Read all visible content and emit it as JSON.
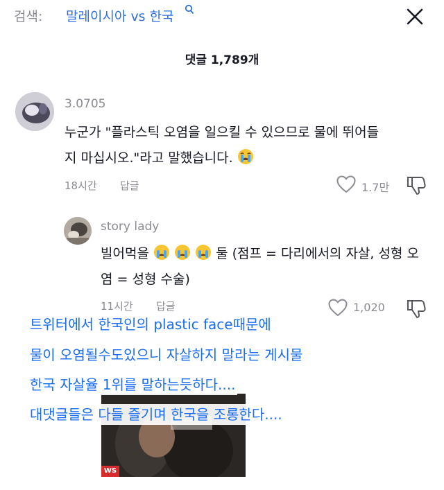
{
  "header": {
    "search_prefix": "검색:",
    "search_query": "말레이시아 vs 한국",
    "search_icon": "search-icon",
    "close_icon": "close-icon"
  },
  "comments_count": "댓글 1,789개",
  "comment": {
    "username": "3.0705",
    "text": "누군가 \"플라스틱 오염을 일으킬 수 있으므로 물에 뛰어들지 마십시오.\"라고 말했습니다.",
    "emoji": "crying-emoji",
    "time": "18시간",
    "reply_label": "답글",
    "likes": "1.7만"
  },
  "reply": {
    "username": "story lady",
    "text_before": "빌어먹을",
    "text_after": "둘 (점프 = 다리에서의 자살, 성형 오염 = 성형 수술)",
    "emoji_count": 3,
    "time": "11시간",
    "reply_label": "답글",
    "likes": "1,020"
  },
  "overlay_captions": [
    "트위터에서 한국인의 plastic face때문에",
    "물이 오염될수도있으니 자살하지 말라는 게시물",
    "한국 자살율 1위를 말하는듯하다....",
    "대댓글들은 다들 즐기며 한국을 조롱한다...."
  ],
  "media": {
    "tag": "WS"
  },
  "colors": {
    "accent": "#2d6fe0",
    "caption": "#1a6df0",
    "muted": "#8a8b91"
  }
}
